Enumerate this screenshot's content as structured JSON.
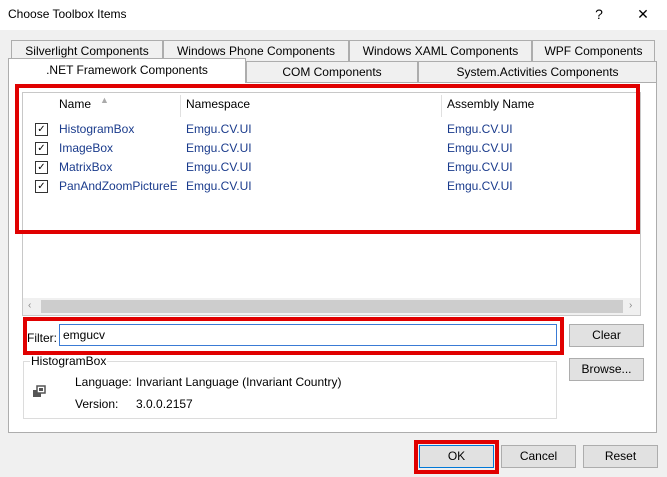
{
  "window": {
    "title": "Choose Toolbox Items",
    "help_glyph": "?",
    "close_glyph": "✕"
  },
  "tabs_row1": [
    "Silverlight Components",
    "Windows Phone Components",
    "Windows XAML Components",
    "WPF Components"
  ],
  "tabs_row2": [
    ".NET Framework Components",
    "COM Components",
    "System.Activities Components"
  ],
  "grid": {
    "columns": [
      "Name",
      "Namespace",
      "Assembly Name"
    ],
    "rows": [
      {
        "checked": true,
        "name": "HistogramBox",
        "namespace": "Emgu.CV.UI",
        "assembly": "Emgu.CV.UI"
      },
      {
        "checked": true,
        "name": "ImageBox",
        "namespace": "Emgu.CV.UI",
        "assembly": "Emgu.CV.UI"
      },
      {
        "checked": true,
        "name": "MatrixBox",
        "namespace": "Emgu.CV.UI",
        "assembly": "Emgu.CV.UI"
      },
      {
        "checked": true,
        "name": "PanAndZoomPictureE",
        "namespace": "Emgu.CV.UI",
        "assembly": "Emgu.CV.UI"
      }
    ]
  },
  "filter": {
    "label": "Filter:",
    "value": "emgucv",
    "clear_label": "Clear"
  },
  "details": {
    "title": "HistogramBox",
    "language_label": "Language:",
    "language_value": "Invariant Language (Invariant Country)",
    "version_label": "Version:",
    "version_value": "3.0.0.2157",
    "browse_label": "Browse..."
  },
  "footer": {
    "ok_label": "OK",
    "cancel_label": "Cancel",
    "reset_label": "Reset"
  },
  "colors": {
    "highlight": "#e00000",
    "link_text": "#1a3b8c"
  }
}
